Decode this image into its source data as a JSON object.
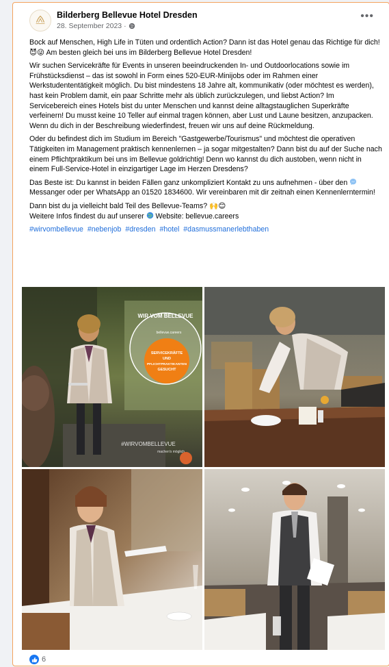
{
  "post": {
    "page_name": "Bilderberg Bellevue Hotel Dresden",
    "date": "28. September 2023",
    "meta_separator": "·",
    "paragraphs": [
      "Bock auf Menschen, High Life in Tüten und ordentlich Action? Dann ist das Hotel genau das Richtige für dich! 😈😜 Am besten gleich bei uns im Bilderberg Bellevue Hotel Dresden!",
      "Wir suchen Servicekräfte für Events in unseren beeindruckenden In- und Outdoorlocations sowie im Frühstücksdienst – das ist sowohl in Form eines 520-EUR-Minijobs oder im Rahmen einer Werkstudententätigkeit möglich. Du bist mindestens 18 Jahre alt, kommunikativ (oder möchtest es werden), hast kein Problem damit, ein paar Schritte mehr als üblich zurückzulegen, und liebst Action? Im Servicebereich eines Hotels bist du unter Menschen und kannst deine alltagstauglichen Superkräfte verfeinern! Du musst keine 10 Teller auf einmal tragen können, aber Lust und Laune besitzen, anzupacken. Wenn du dich in der Beschreibung wiederfindest, freuen wir uns auf deine Rückmeldung.",
      "Oder du befindest dich im Studium im Bereich \"Gastgewerbe/Tourismus\" und möchtest die operativen Tätigkeiten im Management praktisch kennenlernen – ja sogar mitgestalten? Dann bist du auf der Suche nach einem Pflichtpraktikum bei uns im Bellevue goldrichtig! Denn wo kannst du dich austoben, wenn nicht in einem Full-Service-Hotel in einzigartiger Lage im Herzen Dresdens?"
    ],
    "contact_part1": "Das Beste ist: Du kannst in beiden Fällen ganz unkompliziert Kontakt zu uns aufnehmen - über den",
    "contact_part2": "Messanger oder per WhatsApp an 01520 1834600. Wir vereinbaren mit dir zeitnah einen Kennenlerntermin!",
    "closing_line1": "Dann bist du ja vielleicht bald Teil des Bellevue-Teams? 🙌😊",
    "closing_line2_prefix": "Weitere Infos findest du auf unserer",
    "closing_line2_suffix": "Website: bellevue.careers",
    "hashtags": [
      "#wirvombellevue",
      "#nebenjob",
      "#dresden",
      "#hotel",
      "#dasmussmanerlebthaben"
    ],
    "reaction_count": "6"
  },
  "photos": {
    "badge_top": "WIR VOM BELLEVUE",
    "badge_small": "bellevue.careers",
    "badge_line1": "SERVICEKRÄFTE",
    "badge_line2": "UND",
    "badge_line3": "PFLICHTPRAKTIKANTEN",
    "badge_line4": "GESUCHT",
    "watermark": "#WIRVOMBELLEVUE",
    "watermark_sub": "machen's möglich"
  },
  "colors": {
    "accent_border": "#f3a25c",
    "link": "#216fdb",
    "like_blue": "#1877f2",
    "badge_orange": "#f07f14"
  }
}
